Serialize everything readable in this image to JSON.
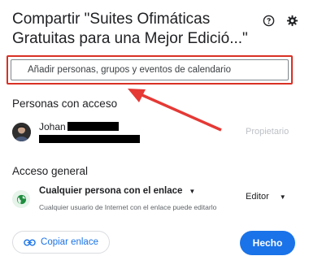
{
  "dialog": {
    "title": "Compartir \"Suites Ofimáticas Gratuitas para una Mejor Edició...\"",
    "help_icon": "help-circle-icon",
    "settings_icon": "gear-icon"
  },
  "share": {
    "placeholder": "Añadir personas, grupos y eventos de calendario"
  },
  "people": {
    "heading": "Personas con acceso",
    "items": [
      {
        "name": "Johan",
        "role": "Propietario"
      }
    ]
  },
  "general_access": {
    "heading": "Acceso general",
    "selected": "Cualquier persona con el enlace",
    "description": "Cualquier usuario de Internet con el enlace puede editarlo",
    "role": "Editor",
    "icon": "globe-icon"
  },
  "footer": {
    "copy_link_label": "Copiar enlace",
    "done_label": "Hecho"
  },
  "colors": {
    "accent": "#1a73e8",
    "highlight": "#d93025",
    "globe_bg": "#e6f4ea",
    "globe_fg": "#1e8e3e"
  }
}
